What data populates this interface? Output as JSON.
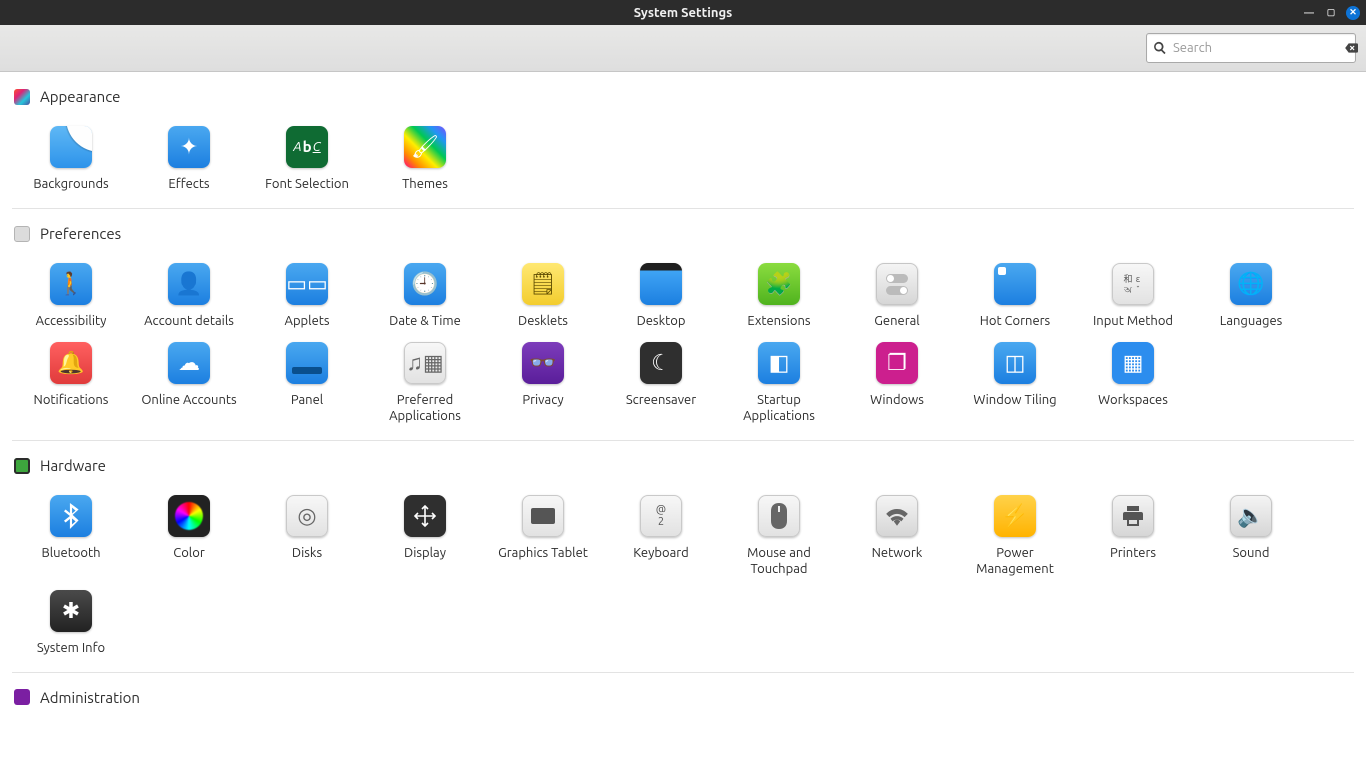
{
  "window": {
    "title": "System Settings"
  },
  "search": {
    "placeholder": "Search",
    "value": ""
  },
  "sections": [
    {
      "title": "Appearance",
      "cat_class": "cat-appearance",
      "items": [
        {
          "label": "Backgrounds",
          "icon": "bg-backgrounds",
          "name": "backgrounds"
        },
        {
          "label": "Effects",
          "icon": "bg-blue",
          "glyph": "✦",
          "name": "effects"
        },
        {
          "label": "Font Selection",
          "icon": "bg-darkgreen",
          "font_icon": true,
          "name": "font-selection"
        },
        {
          "label": "Themes",
          "icon": "bg-rainbow",
          "glyph": "🖌",
          "name": "themes"
        }
      ]
    },
    {
      "title": "Preferences",
      "cat_class": "cat-preferences",
      "items": [
        {
          "label": "Accessibility",
          "icon": "bg-blue",
          "glyph": "🚶",
          "name": "accessibility"
        },
        {
          "label": "Account details",
          "icon": "bg-blue",
          "glyph": "👤",
          "name": "account-details"
        },
        {
          "label": "Applets",
          "icon": "bg-blue",
          "glyph": "▭▭",
          "name": "applets"
        },
        {
          "label": "Date & Time",
          "icon": "bg-blue",
          "glyph": "🕘",
          "name": "date-time"
        },
        {
          "label": "Desklets",
          "icon": "bg-yellow",
          "glyph": "🗒",
          "name": "desklets"
        },
        {
          "label": "Desktop",
          "icon": "bg-desktop",
          "name": "desktop"
        },
        {
          "label": "Extensions",
          "icon": "bg-green",
          "glyph": "🧩",
          "name": "extensions"
        },
        {
          "label": "General",
          "icon": "bg-grey",
          "glyph": "⚙",
          "small": true,
          "name": "general",
          "toggles": true
        },
        {
          "label": "Hot Corners",
          "icon": "bg-blue",
          "corner": true,
          "name": "hot-corners"
        },
        {
          "label": "Input Method",
          "icon": "bg-ltgrey",
          "ime": true,
          "name": "input-method"
        },
        {
          "label": "Languages",
          "icon": "bg-blue",
          "glyph": "🌐",
          "name": "languages"
        },
        {
          "label": "Notifications",
          "icon": "bg-red",
          "glyph": "🔔",
          "name": "notifications"
        },
        {
          "label": "Online Accounts",
          "icon": "bg-blue",
          "glyph": "☁",
          "name": "online-accounts"
        },
        {
          "label": "Panel",
          "icon": "bg-blue",
          "panel": true,
          "name": "panel"
        },
        {
          "label": "Preferred Applications",
          "icon": "bg-ltgrey",
          "glyph": "♫▦",
          "name": "preferred-applications"
        },
        {
          "label": "Privacy",
          "icon": "bg-purple",
          "glyph": "👓",
          "name": "privacy"
        },
        {
          "label": "Screensaver",
          "icon": "bg-black",
          "glyph": "☾",
          "name": "screensaver"
        },
        {
          "label": "Startup Applications",
          "icon": "bg-blue",
          "glyph": "◧",
          "name": "startup-applications"
        },
        {
          "label": "Windows",
          "icon": "bg-pink",
          "glyph": "❐",
          "name": "windows"
        },
        {
          "label": "Window Tiling",
          "icon": "bg-blue",
          "glyph": "◫",
          "name": "window-tiling"
        },
        {
          "label": "Workspaces",
          "icon": "bg-blue-solid",
          "glyph": "▦",
          "name": "workspaces"
        }
      ]
    },
    {
      "title": "Hardware",
      "cat_class": "cat-hardware",
      "items": [
        {
          "label": "Bluetooth",
          "icon": "bg-blue",
          "bt": true,
          "name": "bluetooth"
        },
        {
          "label": "Color",
          "icon": "colorwheel",
          "name": "color"
        },
        {
          "label": "Disks",
          "icon": "bg-ltgrey",
          "glyph": "◎",
          "name": "disks"
        },
        {
          "label": "Display",
          "icon": "bg-black",
          "display_arrows": true,
          "name": "display"
        },
        {
          "label": "Graphics Tablet",
          "icon": "bg-ltgrey",
          "tablet": true,
          "name": "graphics-tablet"
        },
        {
          "label": "Keyboard",
          "icon": "bg-ltgrey",
          "key": true,
          "name": "keyboard"
        },
        {
          "label": "Mouse and Touchpad",
          "icon": "bg-ltgrey",
          "mouse": true,
          "name": "mouse-touchpad"
        },
        {
          "label": "Network",
          "icon": "bg-grey",
          "wifi": true,
          "name": "network"
        },
        {
          "label": "Power Management",
          "icon": "bg-orange",
          "glyph": "⚡",
          "name": "power-management"
        },
        {
          "label": "Printers",
          "icon": "bg-grey",
          "printer": true,
          "name": "printers"
        },
        {
          "label": "Sound",
          "icon": "bg-grey",
          "glyph": "🔈",
          "name": "sound"
        },
        {
          "label": "System Info",
          "icon": "bg-blackglass",
          "glyph": "✱",
          "name": "system-info"
        }
      ]
    },
    {
      "title": "Administration",
      "cat_class": "cat-admin",
      "items": []
    }
  ]
}
